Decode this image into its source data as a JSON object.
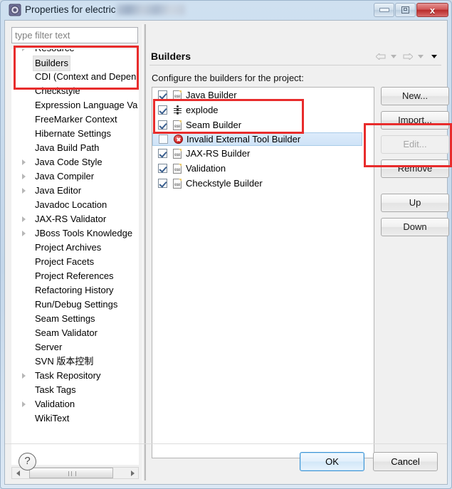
{
  "window": {
    "title": "Properties for electric",
    "title_redacted": true,
    "icon": "properties-gear-icon",
    "controls": {
      "minimize": "Minimize",
      "maximize": "Restore",
      "close": "x"
    }
  },
  "sidebar": {
    "filter": {
      "placeholder": "type filter text",
      "value": ""
    },
    "items": [
      {
        "label": "Resource",
        "expandable": true,
        "selected": false
      },
      {
        "label": "Builders",
        "expandable": false,
        "selected": true
      },
      {
        "label": "CDI (Context and Depen",
        "expandable": false,
        "selected": false
      },
      {
        "label": "Checkstyle",
        "expandable": false,
        "selected": false
      },
      {
        "label": "Expression Language Va",
        "expandable": false,
        "selected": false
      },
      {
        "label": "FreeMarker Context",
        "expandable": false,
        "selected": false
      },
      {
        "label": "Hibernate Settings",
        "expandable": false,
        "selected": false
      },
      {
        "label": "Java Build Path",
        "expandable": false,
        "selected": false
      },
      {
        "label": "Java Code Style",
        "expandable": true,
        "selected": false
      },
      {
        "label": "Java Compiler",
        "expandable": true,
        "selected": false
      },
      {
        "label": "Java Editor",
        "expandable": true,
        "selected": false
      },
      {
        "label": "Javadoc Location",
        "expandable": false,
        "selected": false
      },
      {
        "label": "JAX-RS Validator",
        "expandable": true,
        "selected": false
      },
      {
        "label": "JBoss Tools Knowledge",
        "expandable": true,
        "selected": false
      },
      {
        "label": "Project Archives",
        "expandable": false,
        "selected": false
      },
      {
        "label": "Project Facets",
        "expandable": false,
        "selected": false
      },
      {
        "label": "Project References",
        "expandable": false,
        "selected": false
      },
      {
        "label": "Refactoring History",
        "expandable": false,
        "selected": false
      },
      {
        "label": "Run/Debug Settings",
        "expandable": false,
        "selected": false
      },
      {
        "label": "Seam Settings",
        "expandable": false,
        "selected": false
      },
      {
        "label": "Seam Validator",
        "expandable": false,
        "selected": false
      },
      {
        "label": "Server",
        "expandable": false,
        "selected": false
      },
      {
        "label": "SVN 版本控制",
        "expandable": false,
        "selected": false
      },
      {
        "label": "Task Repository",
        "expandable": true,
        "selected": false
      },
      {
        "label": "Task Tags",
        "expandable": false,
        "selected": false
      },
      {
        "label": "Validation",
        "expandable": true,
        "selected": false
      },
      {
        "label": "WikiText",
        "expandable": false,
        "selected": false
      }
    ]
  },
  "page": {
    "title": "Builders",
    "description": "Configure the builders for the project:",
    "nav": [
      {
        "name": "back-arrow-icon",
        "enabled": false
      },
      {
        "name": "back-dropdown-icon",
        "enabled": false
      },
      {
        "name": "forward-arrow-icon",
        "enabled": false
      },
      {
        "name": "forward-dropdown-icon",
        "enabled": false
      },
      {
        "name": "view-menu-dropdown-icon",
        "enabled": true
      }
    ]
  },
  "builders": [
    {
      "label": "Java Builder",
      "checked": true,
      "selected": false,
      "icon": "builder-010-icon"
    },
    {
      "label": "explode",
      "checked": true,
      "selected": false,
      "icon": "ant-builder-icon"
    },
    {
      "label": "Seam Builder",
      "checked": true,
      "selected": false,
      "icon": "builder-010-icon"
    },
    {
      "label": "Invalid External Tool Builder",
      "checked": false,
      "selected": true,
      "icon": "error-icon"
    },
    {
      "label": "JAX-RS Builder",
      "checked": true,
      "selected": false,
      "icon": "builder-010-icon"
    },
    {
      "label": "Validation",
      "checked": true,
      "selected": false,
      "icon": "builder-010-icon"
    },
    {
      "label": "Checkstyle Builder",
      "checked": true,
      "selected": false,
      "icon": "builder-010-icon"
    }
  ],
  "side_buttons": [
    {
      "label": "New...",
      "enabled": true
    },
    {
      "label": "Import...",
      "enabled": true
    },
    {
      "label": "Edit...",
      "enabled": false
    },
    {
      "label": "Remove",
      "enabled": true
    },
    {
      "label": "Up",
      "enabled": true
    },
    {
      "label": "Down",
      "enabled": true
    }
  ],
  "footer": {
    "help": "?",
    "ok": "OK",
    "cancel": "Cancel"
  },
  "annotations": {
    "color": "#e82c2c",
    "boxes": [
      {
        "name": "sidebar-builders-highlight"
      },
      {
        "name": "invalid-builder-highlight"
      },
      {
        "name": "remove-button-highlight"
      }
    ]
  }
}
